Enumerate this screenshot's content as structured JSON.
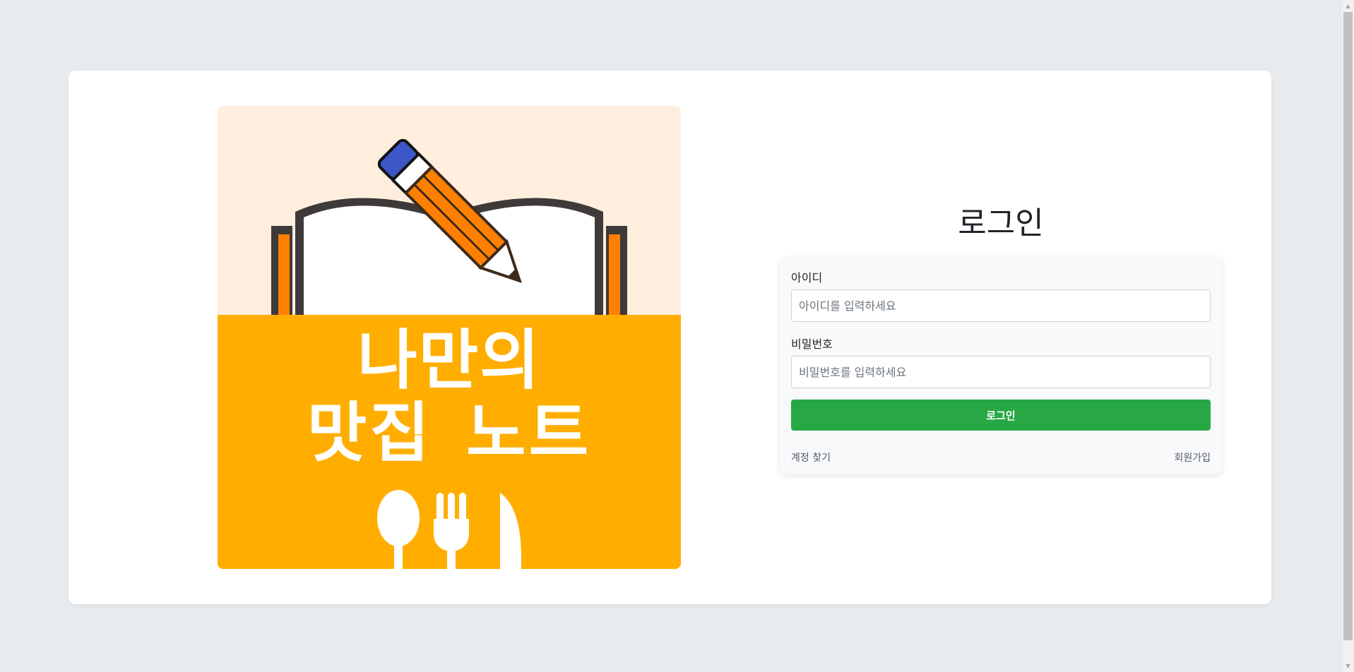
{
  "logo": {
    "line1": "나만의",
    "line2": "맛집 노트",
    "colors": {
      "top_bg": "#ffeedd",
      "bottom_bg": "#ffae00",
      "pencil": "#ff8000",
      "eraser": "#3b57c8",
      "book_outline": "#3e3a39"
    },
    "icons": [
      "book-icon",
      "pencil-icon",
      "spoon-icon",
      "fork-icon",
      "knife-icon"
    ]
  },
  "login": {
    "title": "로그인",
    "id_label": "아이디",
    "id_placeholder": "아이디를 입력하세요",
    "id_value": "",
    "pw_label": "비밀번호",
    "pw_placeholder": "비밀번호를 입력하세요",
    "pw_value": "",
    "submit_label": "로그인",
    "find_account_label": "계정 찾기",
    "signup_label": "회원가입"
  },
  "colors": {
    "page_bg": "#e8ebee",
    "card_bg": "#ffffff",
    "button": "#28a745"
  }
}
